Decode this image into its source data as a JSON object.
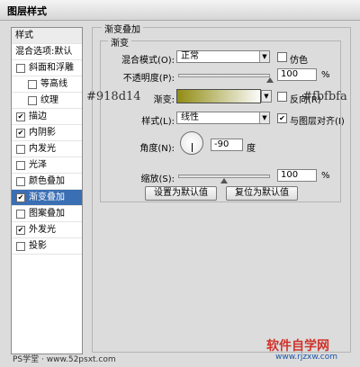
{
  "window": {
    "title": "图层样式"
  },
  "sidebar": {
    "header": "样式",
    "blend_options": "混合选项:默认",
    "items": [
      {
        "label": "斜面和浮雕",
        "checked": false,
        "indent": false,
        "selected": false
      },
      {
        "label": "等高线",
        "checked": false,
        "indent": true,
        "selected": false
      },
      {
        "label": "纹理",
        "checked": false,
        "indent": true,
        "selected": false
      },
      {
        "label": "描边",
        "checked": true,
        "indent": false,
        "selected": false
      },
      {
        "label": "内阴影",
        "checked": true,
        "indent": false,
        "selected": false
      },
      {
        "label": "内发光",
        "checked": false,
        "indent": false,
        "selected": false
      },
      {
        "label": "光泽",
        "checked": false,
        "indent": false,
        "selected": false
      },
      {
        "label": "颜色叠加",
        "checked": false,
        "indent": false,
        "selected": false
      },
      {
        "label": "渐变叠加",
        "checked": true,
        "indent": false,
        "selected": true
      },
      {
        "label": "图案叠加",
        "checked": false,
        "indent": false,
        "selected": false
      },
      {
        "label": "外发光",
        "checked": true,
        "indent": false,
        "selected": false
      },
      {
        "label": "投影",
        "checked": false,
        "indent": false,
        "selected": false
      }
    ]
  },
  "panel": {
    "title": "渐变叠加",
    "group_title": "渐变",
    "blend_mode": {
      "label": "混合模式(O):",
      "value": "正常"
    },
    "dither": {
      "label": "仿色",
      "checked": false
    },
    "opacity": {
      "label": "不透明度(P):",
      "value": "100",
      "unit": "%",
      "percent": 100
    },
    "gradient": {
      "label": "渐变:",
      "start_color": "#918d14",
      "end_color": "#fbfbfa"
    },
    "reverse": {
      "label": "反向(R)",
      "checked": false
    },
    "style": {
      "label": "样式(L):",
      "value": "线性"
    },
    "align": {
      "label": "与图层对齐(I)",
      "checked": true
    },
    "angle": {
      "label": "角度(N):",
      "value": "-90",
      "unit": "度"
    },
    "scale": {
      "label": "缩放(S):",
      "value": "100",
      "unit": "%",
      "percent": 100
    },
    "buttons": {
      "set_default": "设置为默认值",
      "reset_default": "复位为默认值"
    }
  },
  "annotations": {
    "left_color": "#918d14",
    "right_color": "#fbfbfa"
  },
  "watermarks": {
    "bottom_left": "PS学堂 · www.52psxt.com",
    "bottom_right_brand": "软件自学网",
    "bottom_right_url": "www.rjzxw.com"
  },
  "colors": {
    "selection": "#3b6fb3"
  }
}
